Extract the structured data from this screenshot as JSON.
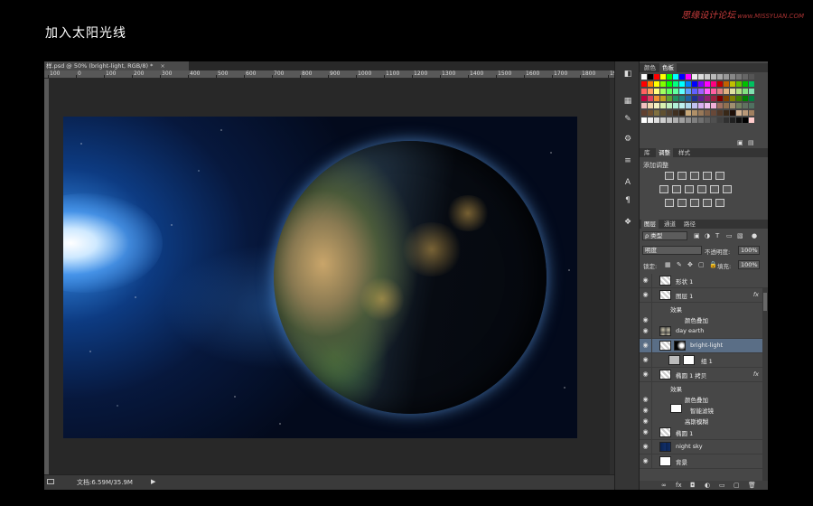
{
  "heading": "加入太阳光线",
  "watermark": {
    "main": "思缘设计论坛",
    "sub": "www.MISSYUAN.COM"
  },
  "document": {
    "tab_title": "样.psd @ 50% (bright-light, RGB/8) *",
    "ruler_ticks": [
      "100",
      "0",
      "100",
      "200",
      "300",
      "400",
      "500",
      "600",
      "700",
      "800",
      "900",
      "1000",
      "1100",
      "1200",
      "1300",
      "1400",
      "1500",
      "1600",
      "1700",
      "1800",
      "1900"
    ],
    "status_text": "文档:6.59M/35.9M"
  },
  "tools": [
    "color-picker",
    "swatch",
    "brush",
    "adjust",
    "sliders",
    "text-tool",
    "paragraph",
    "cube"
  ],
  "tools_glyphs": [
    "◧",
    "▦",
    "✎",
    "⚙",
    "≡",
    "A",
    "¶",
    "❖"
  ],
  "panels": {
    "color_tabs": [
      "颜色",
      "色板"
    ],
    "adjust_tabs": [
      "库",
      "调整",
      "样式"
    ],
    "adjust_title": "添加调整",
    "layers_tabs": [
      "图层",
      "通道",
      "路径"
    ],
    "filter_kind": "ρ 类型",
    "blend_mode": "明度",
    "opacity_label": "不透明度:",
    "opacity_value": "100%",
    "lock_label": "锁定:",
    "fill_label": "填充:",
    "fill_value": "100%",
    "layers": [
      {
        "name": "形状 1",
        "type": "layer"
      },
      {
        "name": "图层 1",
        "type": "layer",
        "fx": "fx"
      },
      {
        "name": "效果",
        "type": "sub"
      },
      {
        "name": "颜色叠加",
        "type": "sub2"
      },
      {
        "name": "day earth",
        "type": "layer"
      },
      {
        "name": "bright-light",
        "type": "layer",
        "selected": true
      },
      {
        "name": "组 1",
        "type": "group"
      },
      {
        "name": "椭圆 1 拷贝",
        "type": "layer",
        "fx": "fx"
      },
      {
        "name": "效果",
        "type": "sub"
      },
      {
        "name": "颜色叠加",
        "type": "sub2"
      },
      {
        "name": "智能滤镜",
        "type": "sub-filter"
      },
      {
        "name": "高斯模糊",
        "type": "sub2"
      },
      {
        "name": "椭圆 1",
        "type": "layer"
      },
      {
        "name": "night sky",
        "type": "layer"
      },
      {
        "name": "背景",
        "type": "background"
      }
    ],
    "bottom_icons": [
      "link-icon",
      "fx-icon",
      "mask-icon",
      "adjustment-icon",
      "folder-icon",
      "new-layer-icon",
      "trash-icon"
    ],
    "bottom_glyphs": [
      "∞",
      "fx",
      "◘",
      "◐",
      "▭",
      "▢",
      "🗑"
    ]
  },
  "colors": {
    "accent_selected": "#5a6e86",
    "panel_bg": "#474747",
    "watermark": "#c53b3b"
  }
}
